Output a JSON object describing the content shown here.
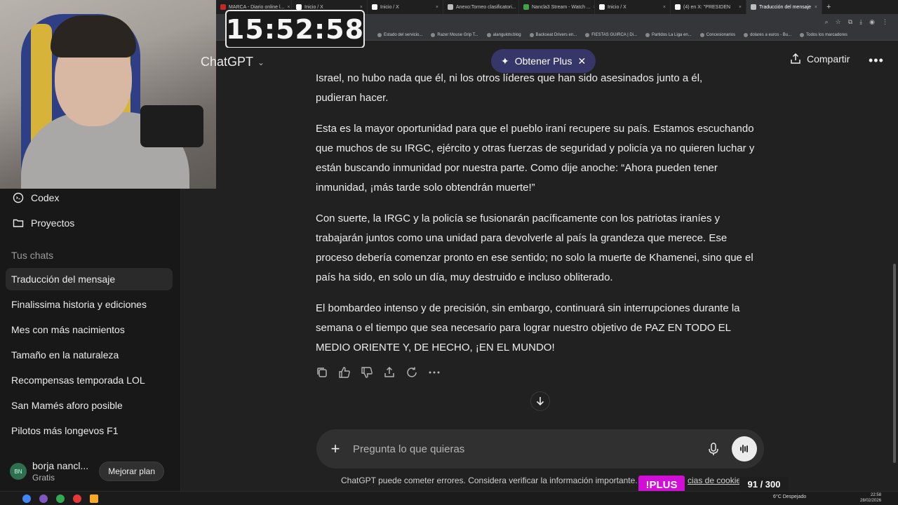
{
  "clock": "15:52:58",
  "browser": {
    "tabs": [
      {
        "label": "MARCA - Diario online l...",
        "color": "#c62828"
      },
      {
        "label": "Inicio / X",
        "color": "#ffffff"
      },
      {
        "label": "Inicio / X",
        "color": "#ffffff"
      },
      {
        "label": "Anexo:Torneo clasificatori...",
        "color": "#bdbdbd"
      },
      {
        "label": "Nancla3 Stream - Watch ...",
        "color": "#43a047"
      },
      {
        "label": "Inicio / X",
        "color": "#ffffff"
      },
      {
        "label": "(4) en X: \"PRESIDEN",
        "color": "#ffffff"
      },
      {
        "label": "Traducción del mensaje",
        "color": "#bdbdbd"
      }
    ],
    "bookmarks": [
      "Estado del servicio...",
      "Razer Mouse Grip T...",
      "alangulotv.blog",
      "Backseat Drivers en...",
      "FIESTAS GUIRCA | Di...",
      "Partidos La Liga en...",
      "Concesionarios",
      "dolares a euros - Bu...",
      "Todos los marcadores"
    ]
  },
  "header": {
    "model": "ChatGPT",
    "plus_pill": "Obtener Plus",
    "share": "Compartir"
  },
  "sidebar": {
    "top_items": [
      {
        "label": "Codex",
        "icon": "codex-icon"
      },
      {
        "label": "Proyectos",
        "icon": "folder-icon"
      }
    ],
    "section_label": "Tus chats",
    "chats": [
      "Traducción del mensaje",
      "Finalissima historia y ediciones",
      "Mes con más nacimientos",
      "Tamaño en la naturaleza",
      "Recompensas temporada LOL",
      "San Mamés aforo posible",
      "Pilotos más longevos F1"
    ],
    "user": {
      "initials": "BN",
      "name": "borja nancl...",
      "plan": "Gratis",
      "upgrade": "Mejorar plan"
    }
  },
  "message": {
    "partial_lines": [
      "Israel, no hubo nada que él, ni los otros líderes que han sido asesinados junto a él,",
      "pudieran hacer."
    ],
    "paragraphs": [
      "Esta es la mayor oportunidad para que el pueblo iraní recupere su país. Estamos escuchando que muchos de su IRGC, ejército y otras fuerzas de seguridad y policía ya no quieren luchar y están buscando inmunidad por nuestra parte. Como dije anoche: “Ahora pueden tener inmunidad, ¡más tarde solo obtendrán muerte!”",
      "Con suerte, la IRGC y la policía se fusionarán pacíficamente con los patriotas iraníes y trabajarán juntos como una unidad para devolverle al país la grandeza que merece. Ese proceso debería comenzar pronto en ese sentido; no solo la muerte de Khamenei, sino que el país ha sido, en solo un día, muy destruido e incluso obliterado.",
      "El bombardeo intenso y de precisión, sin embargo, continuará sin interrupciones durante la semana o el tiempo que sea necesario para lograr nuestro objetivo de PAZ EN TODO EL MEDIO ORIENTE Y, DE HECHO, ¡EN EL MUNDO!"
    ]
  },
  "composer": {
    "placeholder": "Pregunta lo que quieras"
  },
  "disclaimer": {
    "text": "ChatGPT puede cometer errores. Considera verificar la información importante. V",
    "link": "cias de cookies."
  },
  "overlay": {
    "badge": "!PLUS",
    "counter": "91 / 300"
  },
  "taskbar": {
    "weather": "6°C Despejado",
    "time": "22:58",
    "date": "28/02/2026"
  },
  "colors": {
    "background": "#212121",
    "sidebar": "#181818",
    "plus_pill": "#373669",
    "badge": "#d10ed6"
  }
}
